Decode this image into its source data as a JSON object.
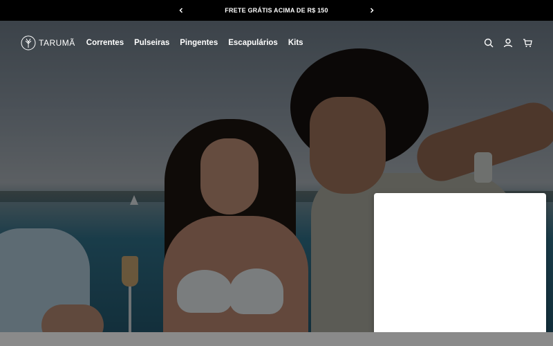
{
  "announcement": {
    "text": "FRETE GRÁTIS ACIMA DE R$ 150",
    "prev_icon": "chevron-left-icon",
    "next_icon": "chevron-right-icon"
  },
  "header": {
    "logo_text": "TARUMÃ",
    "nav": [
      "Correntes",
      "Pulseiras",
      "Pingentes",
      "Escapulários",
      "Kits"
    ],
    "icons": [
      "search-icon",
      "account-icon",
      "cart-icon"
    ]
  },
  "colors": {
    "announcement_bg": "#000000",
    "header_text": "#ffffff",
    "panel_bg": "#ffffff"
  }
}
